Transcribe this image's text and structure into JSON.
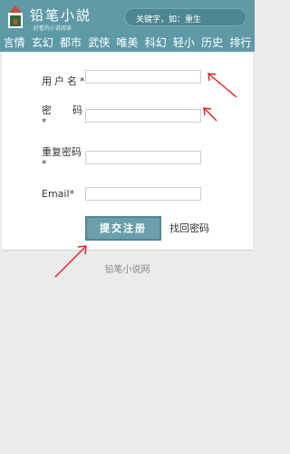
{
  "header": {
    "logo_title": "铅笔小説",
    "logo_slogan": "·好看的小说阅读·",
    "search_placeholder": "关键字，如：重生"
  },
  "nav": {
    "items": [
      {
        "label": "言情"
      },
      {
        "label": "玄幻"
      },
      {
        "label": "都市"
      },
      {
        "label": "武侠"
      },
      {
        "label": "唯美"
      },
      {
        "label": "科幻"
      },
      {
        "label": "轻小"
      },
      {
        "label": "历史"
      },
      {
        "label": "排行"
      }
    ]
  },
  "form": {
    "username_label": "用户名*",
    "password_label_top": "密　码",
    "password_label_star": "*",
    "repeat_label_top": "重复密码",
    "repeat_label_star": "*",
    "email_label": "Email*",
    "username_value": "",
    "password_value": "",
    "repeat_value": "",
    "email_value": "",
    "submit_label": "提交注册",
    "forgot_label": "找回密码"
  },
  "footer": {
    "site_name": "铅笔小说网"
  },
  "colors": {
    "header_bg": "#5e9aa6",
    "button_bg": "#6aa0ab",
    "annotation_arrow": "#e02020"
  }
}
